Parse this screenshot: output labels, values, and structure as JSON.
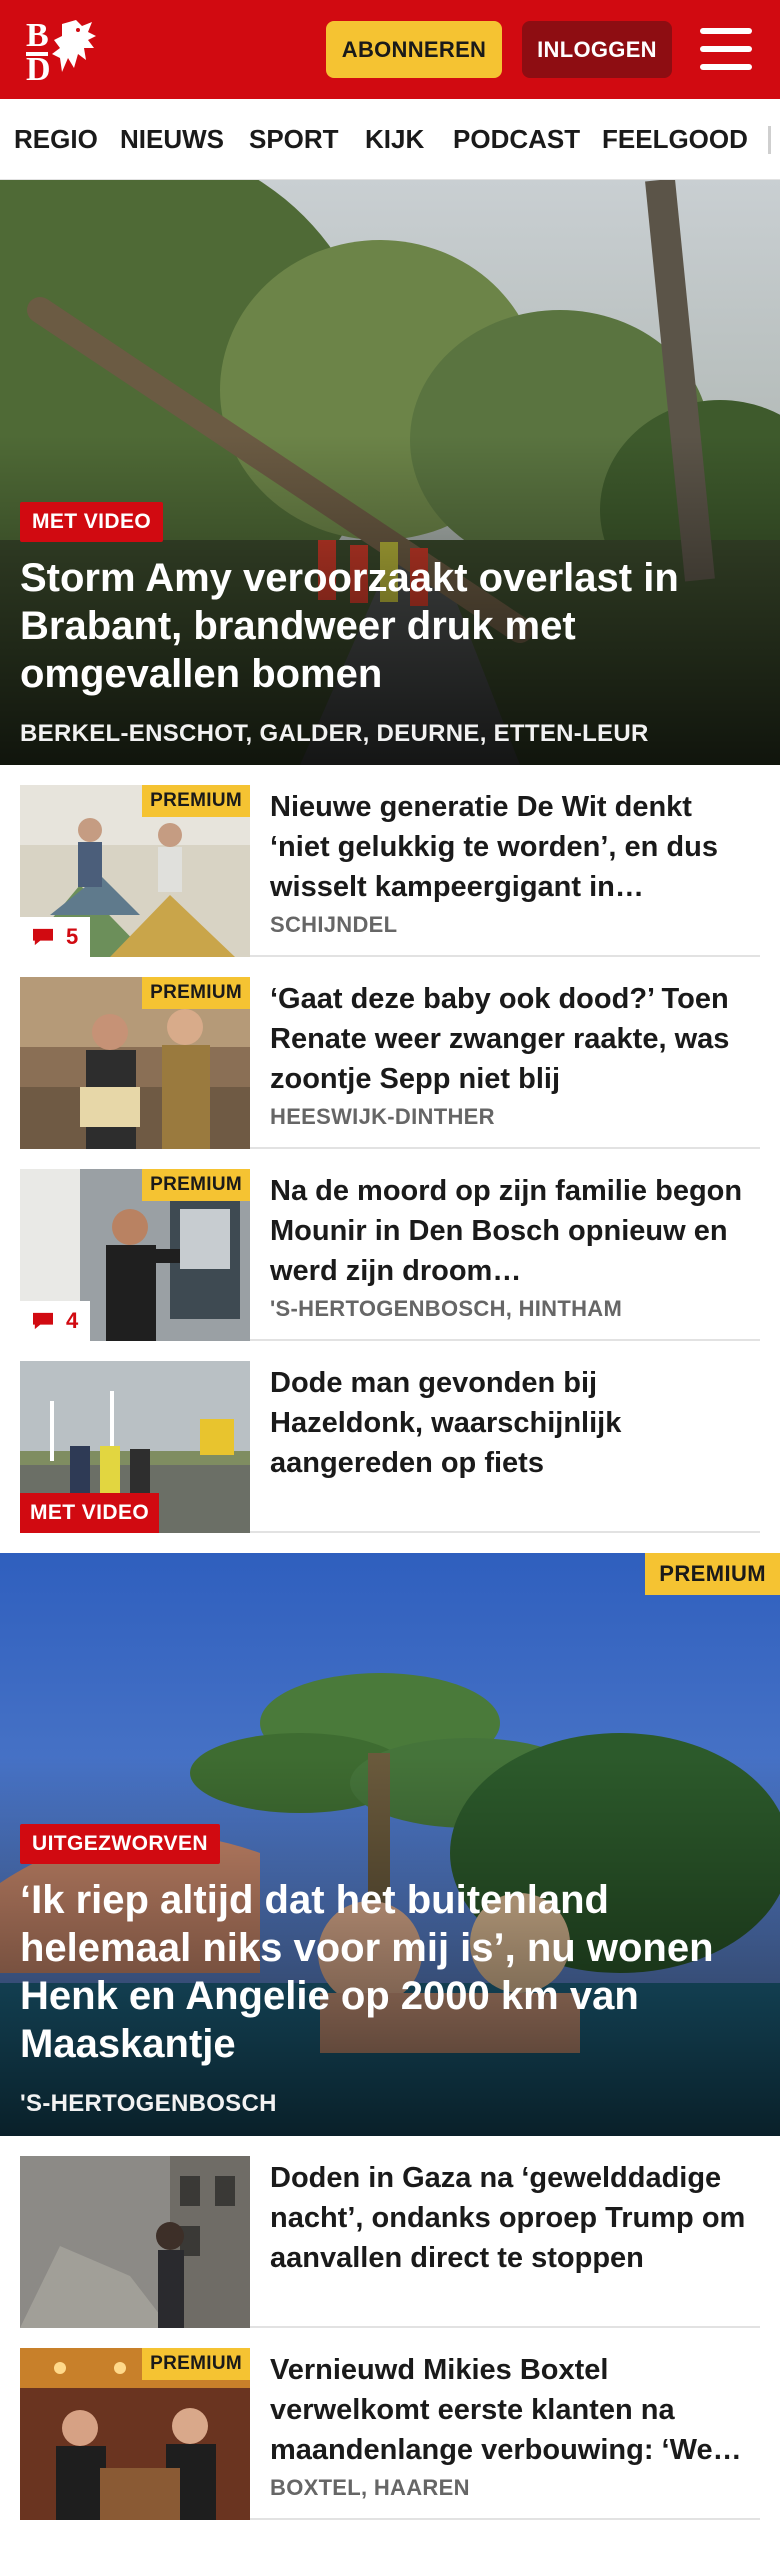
{
  "header": {
    "logo_text": "BD",
    "subscribe_label": "ABONNEREN",
    "login_label": "INLOGGEN",
    "brand_color": "#d10a11",
    "accent_color": "#f5c332"
  },
  "nav": {
    "items": [
      "REGIO",
      "NIEUWS",
      "SPORT",
      "KIJK",
      "PODCAST",
      "FEELGOOD"
    ]
  },
  "hero1": {
    "tag": "MET VIDEO",
    "title": "Storm Amy veroorzaakt overlast in Brabant, brandweer druk met omgevallen bomen",
    "location": "BERKEL-ENSCHOT, GALDER, DEURNE, ETTEN-LEUR"
  },
  "articles1": [
    {
      "title": "Nieuwe generatie De Wit denkt ‘niet gelukkig te worden’, en dus wisselt kampeergigant in…",
      "location": "SCHIJNDEL",
      "premium": "PREMIUM",
      "comments": "5"
    },
    {
      "title": "‘Gaat deze baby ook dood?’ Toen Renate weer zwanger raakte, was zoontje Sepp niet blij",
      "location": "HEESWIJK-DINTHER",
      "premium": "PREMIUM"
    },
    {
      "title": "Na de moord op zijn familie begon Mounir in Den Bosch opnieuw en werd zijn droom…",
      "location": "'S-HERTOGENBOSCH, HINTHAM",
      "premium": "PREMIUM",
      "comments": "4"
    },
    {
      "title": "Dode man gevonden bij Hazeldonk, waarschijnlijk aangereden op fiets",
      "video": "MET VIDEO"
    }
  ],
  "hero2": {
    "premium": "PREMIUM",
    "tag": "UITGEZWORVEN",
    "title": "‘Ik riep altijd dat het buitenland helemaal niks voor mij is’, nu wonen Henk en Angelie op 2000 km van Maaskantje",
    "location": "'S-HERTOGENBOSCH"
  },
  "articles2": [
    {
      "title": "Doden in Gaza na ‘gewelddadige nacht’, ondanks oproep Trump om aanvallen direct te stoppen"
    },
    {
      "title": "Vernieuwd Mikies Boxtel verwelkomt eerste klanten na maandenlange verbouwing: ‘We…",
      "location": "BOXTEL, HAAREN",
      "premium": "PREMIUM"
    }
  ]
}
